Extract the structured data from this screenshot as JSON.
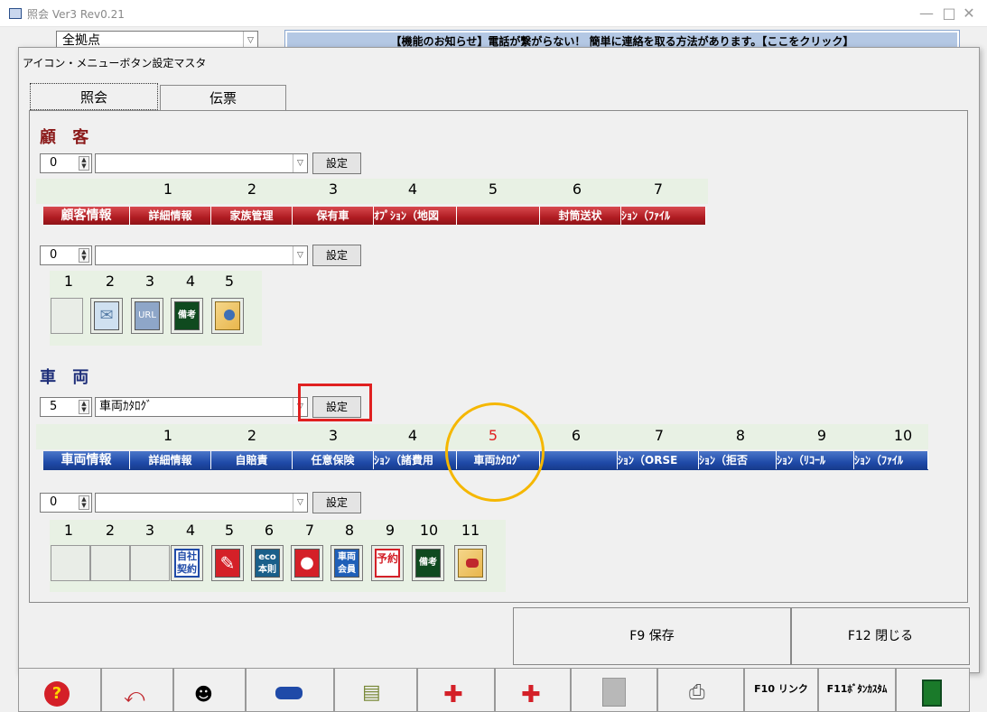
{
  "window": {
    "title": "照会 Ver3 Rev0.21",
    "min": "—",
    "max": "□",
    "close": "✕"
  },
  "top_combo": {
    "value": "全拠点"
  },
  "notice": {
    "text": "【機能のお知らせ】電話が繋がらない！ 簡単に連絡を取る方法があります。【ここをクリック】"
  },
  "dialog": {
    "title": "アイコン・メニューボタン設定マスタ"
  },
  "tabs": [
    "照会",
    "伝票"
  ],
  "customer": {
    "heading": "顧 客",
    "menu_spin": "0",
    "menu_select": "",
    "set_label": "設定",
    "numbers": [
      "1",
      "2",
      "3",
      "4",
      "5",
      "6",
      "7"
    ],
    "bar_head": "顧客情報",
    "bar_cells": [
      "詳細情報",
      "家族管理",
      "保有車",
      "ｵﾌﾟｼｮﾝ（地図",
      "",
      "封筒送状",
      "ｼｮﾝ（ﾌｧｲﾙ"
    ],
    "icon_spin": "0",
    "icon_select": "",
    "icon_set_label": "設定",
    "icon_numbers": [
      "1",
      "2",
      "3",
      "4",
      "5"
    ],
    "icons": [
      {
        "name": "empty-icon",
        "text": ""
      },
      {
        "name": "mail-icon",
        "text": "✉"
      },
      {
        "name": "url-icon",
        "text": "URL"
      },
      {
        "name": "memo-icon",
        "text": "備考"
      },
      {
        "name": "folder-person-icon",
        "text": ""
      }
    ]
  },
  "vehicle": {
    "heading": "車 両",
    "menu_spin": "5",
    "menu_select": "車両ｶﾀﾛｸﾞ",
    "set_label": "設定",
    "numbers": [
      "1",
      "2",
      "3",
      "4",
      "5",
      "6",
      "7",
      "8",
      "9",
      "10"
    ],
    "bar_head": "車両情報",
    "bar_cells": [
      "詳細情報",
      "自賠責",
      "任意保険",
      "ｼｮﾝ（諸費用",
      "車両ｶﾀﾛｸﾞ",
      "",
      "ｼｮﾝ（ORSE",
      "ｼｮﾝ（拒否",
      "ｼｮﾝ（ﾘｺｰﾙ",
      "ｼｮﾝ（ﾌｧｲﾙ"
    ],
    "icon_spin": "0",
    "icon_select": "",
    "icon_set_label": "設定",
    "icon_numbers": [
      "1",
      "2",
      "3",
      "4",
      "5",
      "6",
      "7",
      "8",
      "9",
      "10",
      "11"
    ],
    "icons": [
      {
        "name": "empty-icon",
        "text": ""
      },
      {
        "name": "empty-icon",
        "text": ""
      },
      {
        "name": "empty-icon",
        "text": ""
      },
      {
        "name": "own-contract-icon",
        "text": "自社契約"
      },
      {
        "name": "wrench-icon",
        "text": ""
      },
      {
        "name": "eco-icon",
        "text": "eco本則"
      },
      {
        "name": "drop-icon",
        "text": ""
      },
      {
        "name": "member-icon",
        "text": "車両会員"
      },
      {
        "name": "reserve-icon",
        "text": "予約"
      },
      {
        "name": "memo-icon",
        "text": "備考"
      },
      {
        "name": "folder-car-icon",
        "text": ""
      }
    ]
  },
  "footer": {
    "save_label": "F9 保存",
    "close_label": "F12 閉じる"
  },
  "taskbar": {
    "f10": "F10 リンク",
    "f11": "F11ﾎﾞﾀﾝｶｽﾀﾑ"
  },
  "colors": {
    "customer_bar": "#c0272d",
    "vehicle_bar": "#1f4aa8",
    "highlight_red": "#e02020",
    "highlight_yellow": "#f5b700",
    "heading_red": "#8b1a1a",
    "heading_blue": "#1f2f7a"
  }
}
